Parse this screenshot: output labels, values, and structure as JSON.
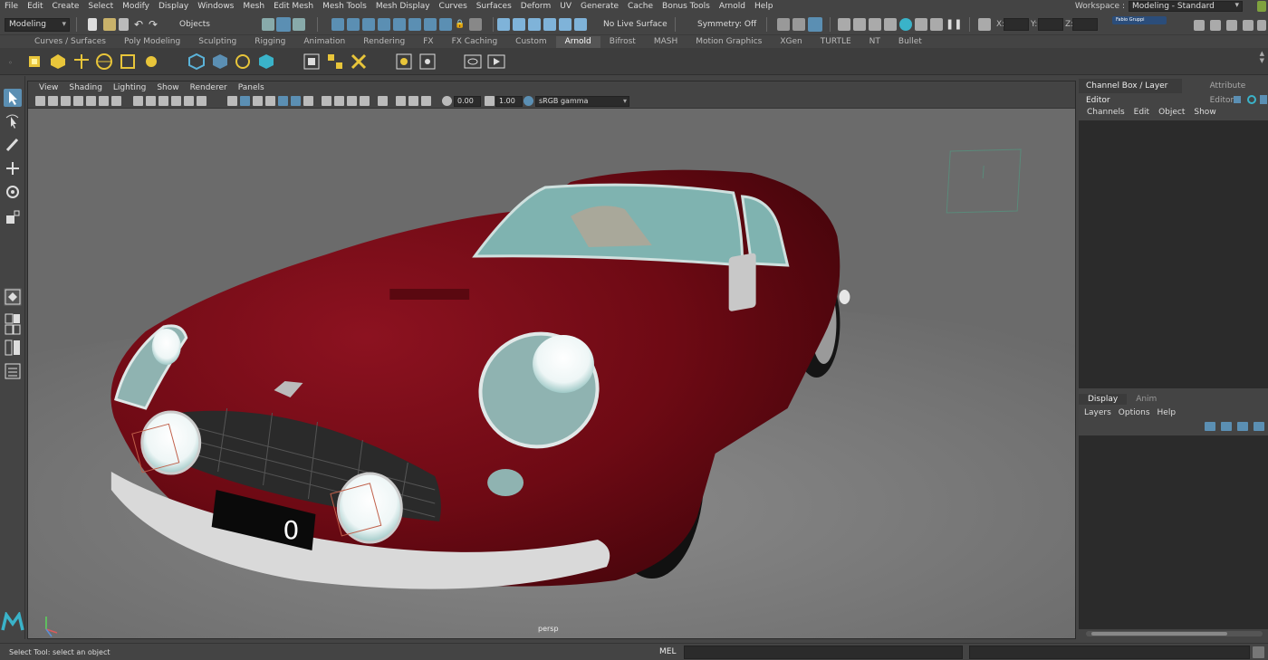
{
  "menubar": {
    "items": [
      "File",
      "Edit",
      "Create",
      "Select",
      "Modify",
      "Display",
      "Windows",
      "Mesh",
      "Edit Mesh",
      "Mesh Tools",
      "Mesh Display",
      "Curves",
      "Surfaces",
      "Deform",
      "UV",
      "Generate",
      "Cache",
      "Bonus Tools",
      "Arnold",
      "Help"
    ]
  },
  "workspace": {
    "label": "Workspace :",
    "value": "Modeling - Standard"
  },
  "statusline": {
    "menu_set": "Modeling",
    "selection_mode": "Objects",
    "live_surface": "No Live Surface",
    "symmetry": "Symmetry: Off",
    "coord_x": "X:",
    "coord_y": "Y:",
    "coord_z": "Z:",
    "user_badge": "Fabio Gruppi"
  },
  "shelf": {
    "tabs": [
      "Curves / Surfaces",
      "Poly Modeling",
      "Sculpting",
      "Rigging",
      "Animation",
      "Rendering",
      "FX",
      "FX Caching",
      "Custom",
      "Arnold",
      "Bifrost",
      "MASH",
      "Motion Graphics",
      "XGen",
      "TURTLE",
      "NT",
      "Bullet"
    ],
    "active_tab": "Arnold"
  },
  "viewport": {
    "menu": [
      "View",
      "Shading",
      "Lighting",
      "Show",
      "Renderer",
      "Panels"
    ],
    "exposure": "0.00",
    "gamma": "1.00",
    "color_space": "sRGB gamma",
    "camera": "persp",
    "plate_text": "0"
  },
  "channel_box": {
    "tabs": [
      "Channel Box / Layer Editor",
      "Attribute Editor"
    ],
    "menu": [
      "Channels",
      "Edit",
      "Object",
      "Show"
    ]
  },
  "layer_editor": {
    "tabs": [
      "Display",
      "Anim"
    ],
    "menu": [
      "Layers",
      "Options",
      "Help"
    ]
  },
  "helpline": {
    "text": "Select Tool: select an object",
    "script_type": "MEL"
  },
  "colors": {
    "car_body": "#6e0a14",
    "glass": "#7fb3b0",
    "ground": "#7a7a7a",
    "accent": "#5b8fb3"
  }
}
